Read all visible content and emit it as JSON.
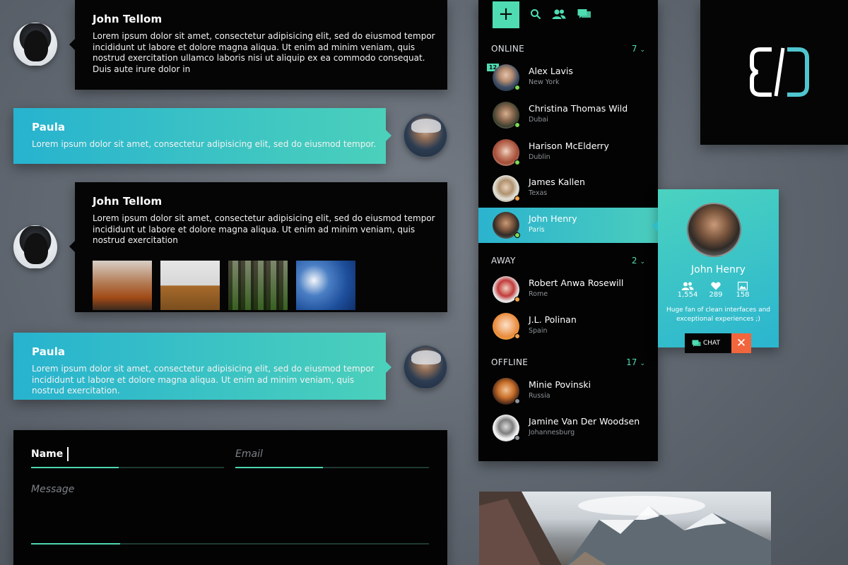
{
  "messages": [
    {
      "author": "John Tellom",
      "text": "Lorem ipsum dolor sit amet, consectetur adipisicing elit, sed do eiusmod tempor incididunt ut labore et dolore magna aliqua. Ut enim ad minim veniam, quis nostrud exercitation ullamco laboris nisi ut aliquip ex ea commodo consequat. Duis aute irure dolor in"
    },
    {
      "author": "Paula",
      "text": "Lorem ipsum dolor sit amet, consectetur adipisicing elit, sed do eiusmod tempor."
    },
    {
      "author": "John Tellom",
      "text": "Lorem ipsum dolor sit amet, consectetur adipisicing elit, sed do eiusmod tempor incididunt ut labore et dolore magna aliqua. Ut enim ad minim veniam, quis nostrud exercitation"
    },
    {
      "author": "Paula",
      "text": "Lorem ipsum dolor sit amet, consectetur adipisicing elit, sed do eiusmod tempor incididunt ut labore et dolore magna aliqua. Ut enim ad minim veniam, quis nostrud exercitation."
    }
  ],
  "form": {
    "name_label": "Name",
    "email_placeholder": "Email",
    "message_placeholder": "Message"
  },
  "contacts": {
    "sections": [
      {
        "title": "ONLINE",
        "count": "7"
      },
      {
        "title": "AWAY",
        "count": "2"
      },
      {
        "title": "OFFLINE",
        "count": "17"
      }
    ],
    "badge": "12",
    "online": [
      {
        "name": "Alex Lavis",
        "city": "New York"
      },
      {
        "name": "Christina Thomas Wild",
        "city": "Dubai"
      },
      {
        "name": "Harison McElderry",
        "city": "Dublin"
      },
      {
        "name": "James Kallen",
        "city": "Texas"
      },
      {
        "name": "John Henry",
        "city": "Paris"
      }
    ],
    "away": [
      {
        "name": "Robert Anwa Rosewill",
        "city": "Rome"
      },
      {
        "name": "J.L. Polinan",
        "city": "Spain"
      }
    ],
    "offline": [
      {
        "name": "Minie Povinski",
        "city": "Russia"
      },
      {
        "name": "Jamine Van Der Woodsen",
        "city": "Johannesburg"
      }
    ]
  },
  "profile": {
    "name": "John Henry",
    "followers": "1,554",
    "likes": "289",
    "photos": "158",
    "bio": "Huge fan of clean interfaces and exceptional experiences ;)",
    "chat_label": "CHAT",
    "close_glyph": "✕"
  },
  "colors": {
    "accent": "#4fdcb2",
    "teal": "#2bb3cf",
    "status_online": "#7dd957",
    "status_away": "#f2a24a",
    "status_offline": "#8e959b",
    "close": "#f2663d"
  }
}
